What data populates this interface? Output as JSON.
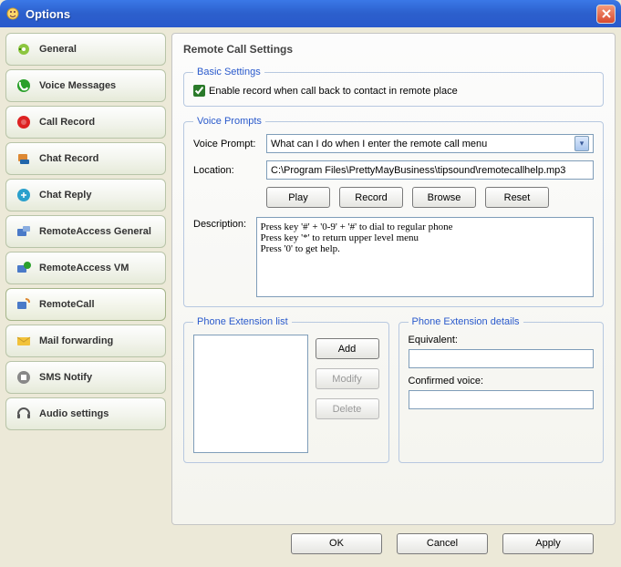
{
  "window": {
    "title": "Options"
  },
  "sidebar": {
    "items": [
      {
        "label": "General"
      },
      {
        "label": "Voice Messages"
      },
      {
        "label": "Call Record"
      },
      {
        "label": "Chat Record"
      },
      {
        "label": "Chat Reply"
      },
      {
        "label": "RemoteAccess General"
      },
      {
        "label": "RemoteAccess VM"
      },
      {
        "label": "RemoteCall"
      },
      {
        "label": "Mail forwarding"
      },
      {
        "label": "SMS Notify"
      },
      {
        "label": "Audio settings"
      }
    ],
    "selected_index": 7
  },
  "main": {
    "title": "Remote Call Settings",
    "basic": {
      "legend": "Basic Settings",
      "enable_label": "Enable record when call back to contact in remote place",
      "enable_checked": true
    },
    "voice": {
      "legend": "Voice Prompts",
      "prompt_label": "Voice Prompt:",
      "prompt_value": "What can I do when I enter the remote call menu",
      "location_label": "Location:",
      "location_value": "C:\\Program Files\\PrettyMayBusiness\\tipsound\\remotecallhelp.mp3",
      "play": "Play",
      "record": "Record",
      "browse": "Browse",
      "reset": "Reset",
      "desc_label": "Description:",
      "desc_value": "Press key '#' + '0-9' + '#' to dial to regular phone\nPress key '*' to return upper level menu\nPress '0' to get help."
    },
    "ext_list": {
      "legend": "Phone Extension list",
      "add": "Add",
      "modify": "Modify",
      "delete": "Delete"
    },
    "ext_details": {
      "legend": "Phone Extension details",
      "equiv_label": "Equivalent:",
      "equiv_value": "",
      "confirmed_label": "Confirmed voice:",
      "confirmed_value": ""
    }
  },
  "buttons": {
    "ok": "OK",
    "cancel": "Cancel",
    "apply": "Apply"
  }
}
